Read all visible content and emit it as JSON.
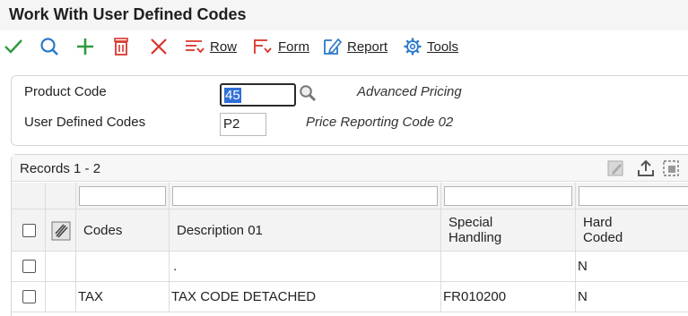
{
  "window": {
    "title": "Work With User Defined Codes"
  },
  "toolbar": {
    "select_icon": "check-icon",
    "find_icon": "search-icon",
    "add_icon": "plus-icon",
    "delete_icon": "trash-icon",
    "close_icon": "x-icon",
    "row_label": "Row",
    "form_label": "Form",
    "report_label": "Report",
    "tools_label": "Tools",
    "colors": {
      "check": "#2e9b3e",
      "search": "#2b7ac9",
      "add": "#2e9b3e",
      "delete": "#d9342b",
      "close": "#d9342b",
      "menu": "#d9342b",
      "report": "#2b7ac9",
      "tools": "#2b7ac9"
    }
  },
  "form": {
    "product_code": {
      "label": "Product Code",
      "value": "45",
      "description": "Advanced Pricing"
    },
    "user_defined_codes": {
      "label": "User Defined Codes",
      "value": "P2",
      "description": "Price Reporting Code 02"
    }
  },
  "grid": {
    "records_label": "Records 1 - 2",
    "columns": [
      {
        "key": "codes",
        "label": "Codes"
      },
      {
        "key": "description",
        "label": "Description 01"
      },
      {
        "key": "special",
        "label": "Special Handling",
        "line1": "Special",
        "line2": "Handling"
      },
      {
        "key": "hard",
        "label": "Hard Coded",
        "line1": "Hard",
        "line2": "Coded"
      }
    ],
    "rows": [
      {
        "codes": "",
        "description": ".",
        "special": "",
        "hard": "N"
      },
      {
        "codes": "TAX",
        "description": "TAX CODE DETACHED",
        "special": "FR010200",
        "hard": "N"
      }
    ]
  }
}
